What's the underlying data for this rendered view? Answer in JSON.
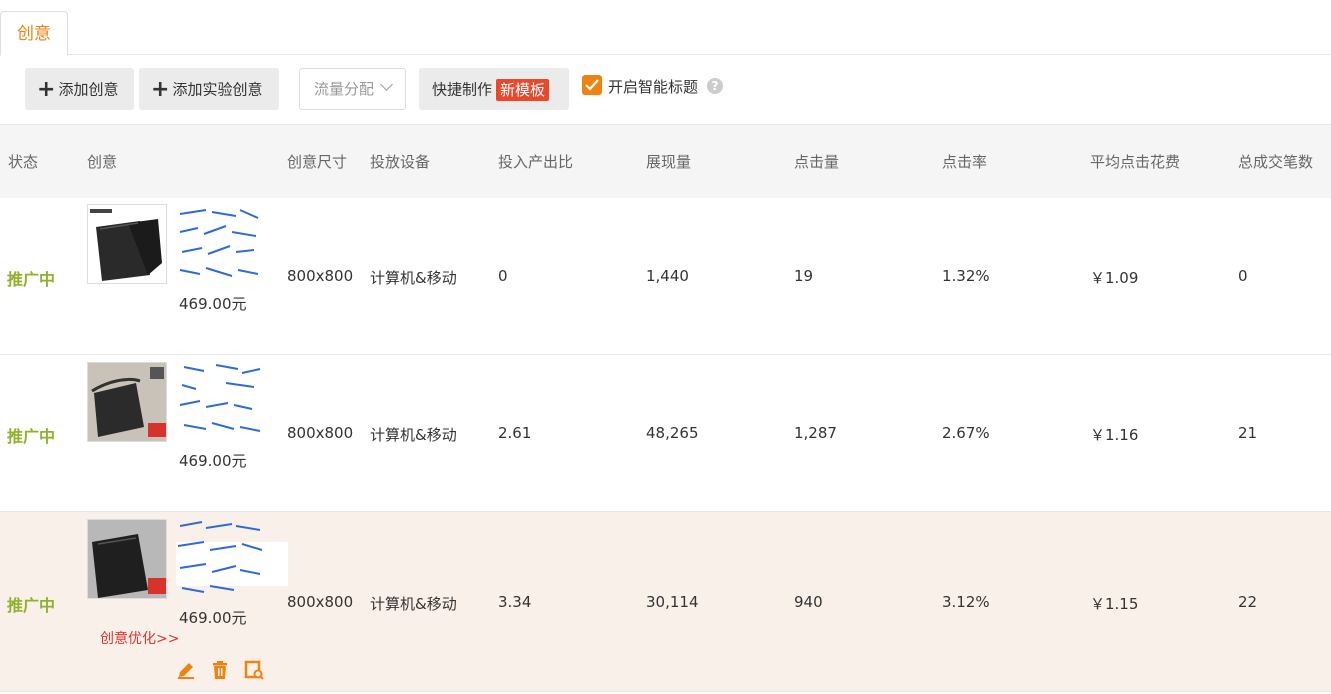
{
  "tabs": {
    "active_label": "创意"
  },
  "toolbar": {
    "add_label": "添加创意",
    "add_experiment_label": "添加实验创意",
    "traffic_label": "流量分配",
    "quick_label": "快捷制作",
    "new_template_badge": "新模板",
    "smart_title_label": "开启智能标题",
    "smart_title_checked": true,
    "help_glyph": "?"
  },
  "table": {
    "headers": [
      "状态",
      "创意",
      "创意尺寸",
      "投放设备",
      "投入产出比",
      "展现量",
      "点击量",
      "点击率",
      "平均点击花费",
      "总成交笔数"
    ],
    "rows": [
      {
        "status": "推广中",
        "price": "469.00元",
        "size": "800x800",
        "device": "计算机&移动",
        "roi": "0",
        "impressions": "1,440",
        "clicks": "19",
        "ctr": "1.32%",
        "cpc": "￥1.09",
        "orders": "0"
      },
      {
        "status": "推广中",
        "price": "469.00元",
        "size": "800x800",
        "device": "计算机&移动",
        "roi": "2.61",
        "impressions": "48,265",
        "clicks": "1,287",
        "ctr": "2.67%",
        "cpc": "￥1.16",
        "orders": "21"
      },
      {
        "status": "推广中",
        "price": "469.00元",
        "size": "800x800",
        "device": "计算机&移动",
        "roi": "3.34",
        "impressions": "30,114",
        "clicks": "940",
        "ctr": "3.12%",
        "cpc": "￥1.15",
        "orders": "22",
        "optimize_label": "创意优化>>"
      }
    ]
  },
  "colors": {
    "accent": "#f08212",
    "status": "#8fb12c",
    "badge": "#e8482c",
    "link": "#e0352b",
    "highlight_row": "#f9f0ea"
  },
  "icons": [
    "plus-icon",
    "chevron-down-icon",
    "checkmark-icon",
    "help-icon",
    "edit-icon",
    "delete-icon",
    "preview-icon"
  ]
}
